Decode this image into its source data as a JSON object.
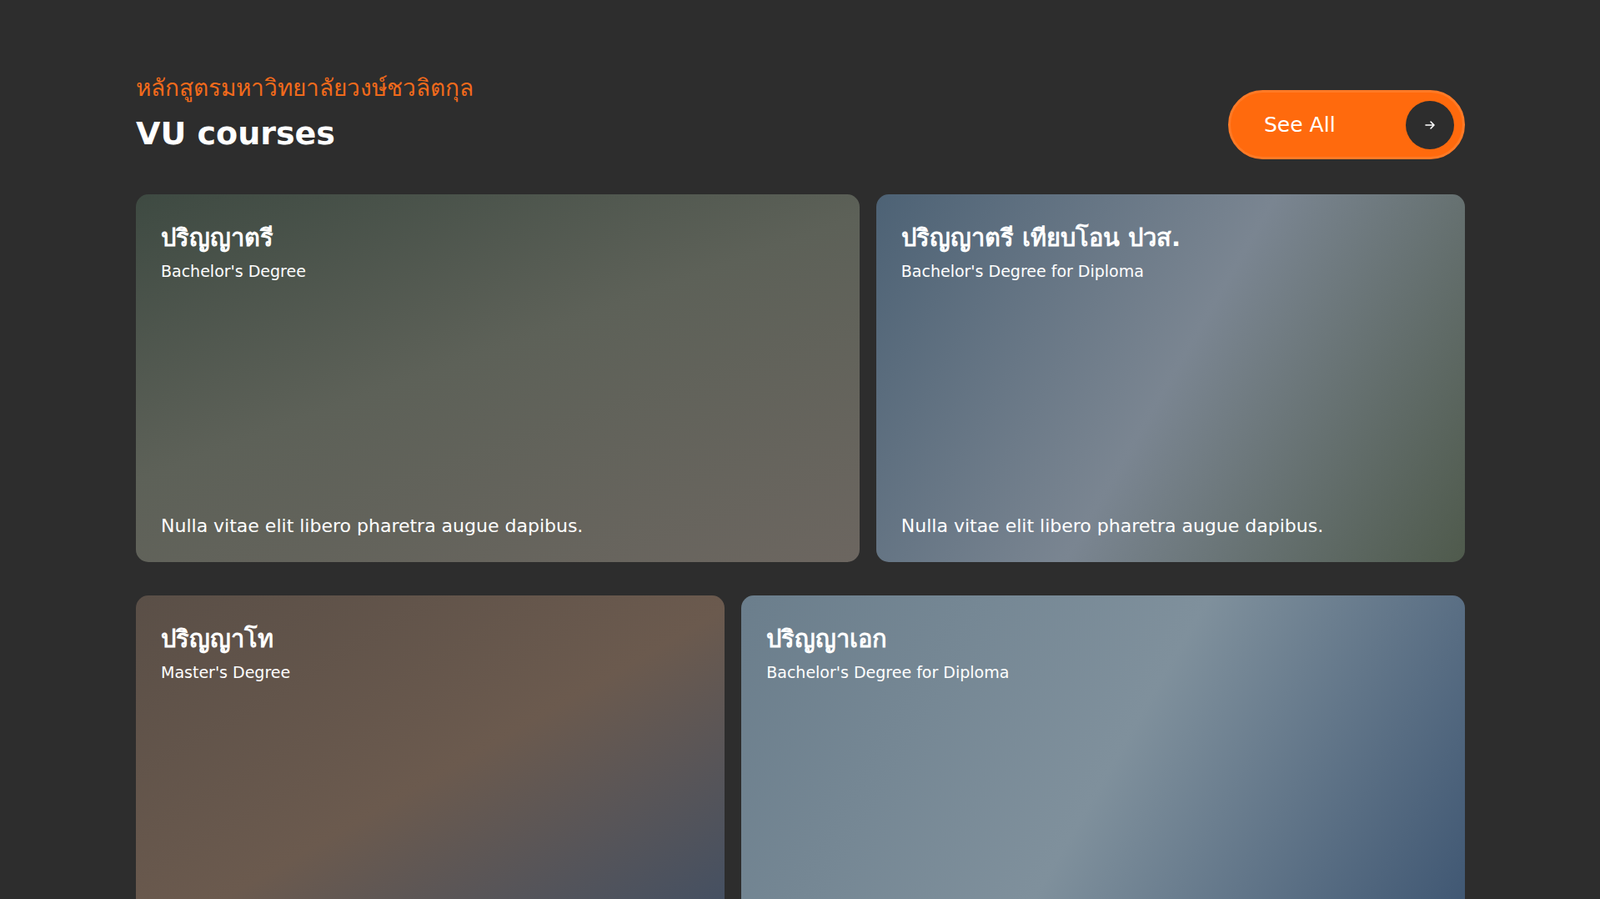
{
  "section": {
    "subtitle": "หลักสูตรมหาวิทยาลัยวงษ์ชวลิตกุล",
    "title": "VU courses"
  },
  "see_all": {
    "label": "See All"
  },
  "rows": [
    [
      {
        "title": "ปริญญาตรี",
        "subtitle": "Bachelor's Degree",
        "description": "Nulla vitae elit libero pharetra augue dapibus."
      },
      {
        "title": "ปริญญาตรี เทียบโอน ปวส.",
        "subtitle": "Bachelor's Degree for Diploma",
        "description": "Nulla vitae elit libero pharetra augue dapibus."
      }
    ],
    [
      {
        "title": "ปริญญาโท",
        "subtitle": "Master's Degree",
        "description": ""
      },
      {
        "title": "ปริญญาเอก",
        "subtitle": "Bachelor's Degree for Diploma",
        "description": ""
      }
    ]
  ]
}
